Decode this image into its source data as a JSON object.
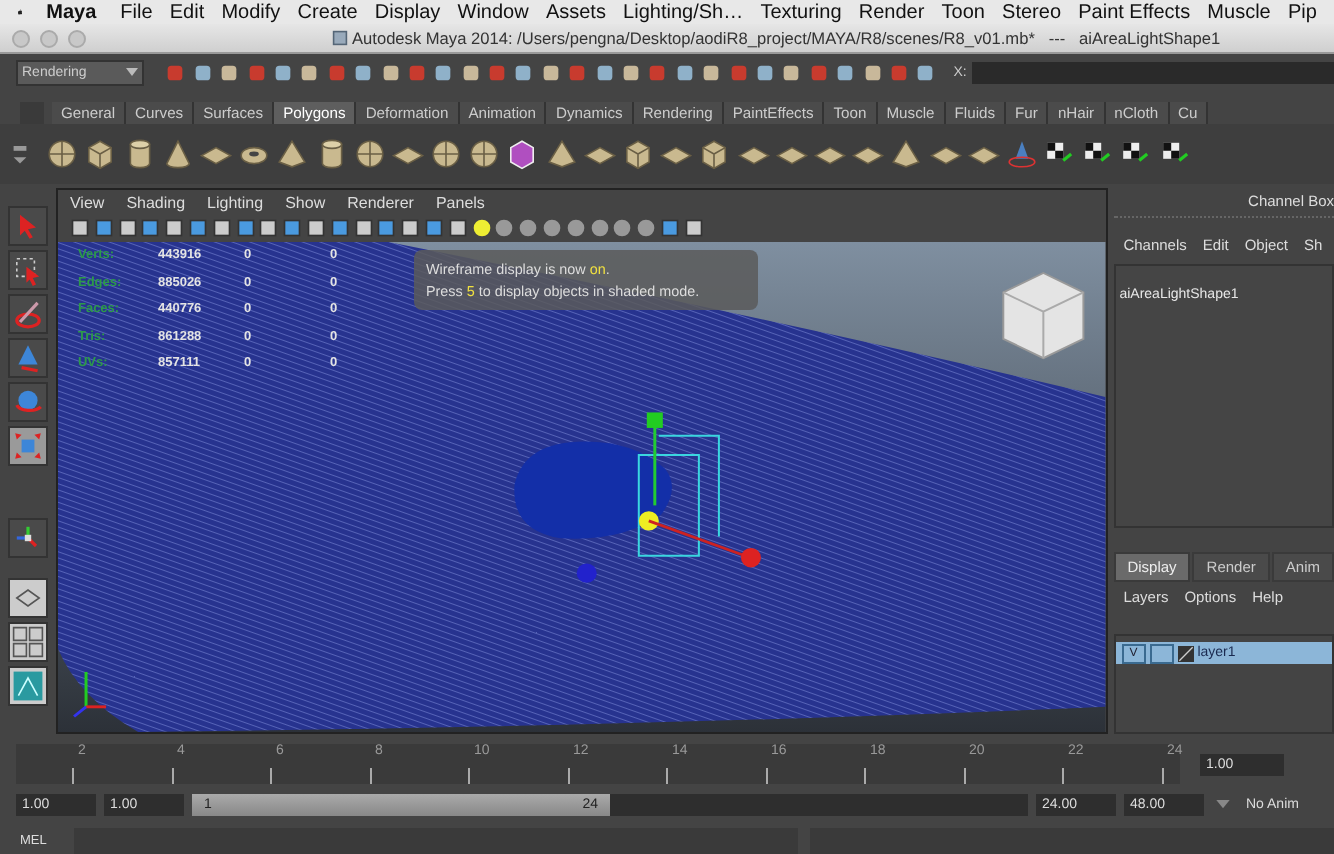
{
  "menu_bar": {
    "app": "Maya",
    "items": [
      "File",
      "Edit",
      "Modify",
      "Create",
      "Display",
      "Window",
      "Assets",
      "Lighting/Sh…",
      "Texturing",
      "Render",
      "Toon",
      "Stereo",
      "Paint Effects",
      "Muscle",
      "Pip"
    ]
  },
  "window": {
    "title": "Autodesk Maya 2014: /Users/pengna/Desktop/aodiR8_project/MAYA/R8/scenes/R8_v01.mb*   ---   aiAreaLightShape1"
  },
  "status_line": {
    "menu_set": "Rendering",
    "field_label": "X:"
  },
  "shelf": {
    "tabs": [
      {
        "label": "General",
        "selected": false
      },
      {
        "label": "Curves",
        "selected": false
      },
      {
        "label": "Surfaces",
        "selected": false
      },
      {
        "label": "Polygons",
        "selected": true
      },
      {
        "label": "Deformation",
        "selected": false
      },
      {
        "label": "Animation",
        "selected": false
      },
      {
        "label": "Dynamics",
        "selected": false
      },
      {
        "label": "Rendering",
        "selected": false
      },
      {
        "label": "PaintEffects",
        "selected": false
      },
      {
        "label": "Toon",
        "selected": false
      },
      {
        "label": "Muscle",
        "selected": false
      },
      {
        "label": "Fluids",
        "selected": false
      },
      {
        "label": "Fur",
        "selected": false
      },
      {
        "label": "nHair",
        "selected": false
      },
      {
        "label": "nCloth",
        "selected": false
      },
      {
        "label": "Cu",
        "selected": false
      }
    ]
  },
  "viewport": {
    "menus": [
      "View",
      "Shading",
      "Lighting",
      "Show",
      "Renderer",
      "Panels"
    ],
    "hud_rows": [
      {
        "label": "Verts:",
        "values": [
          "443916",
          "0",
          "0"
        ]
      },
      {
        "label": "Edges:",
        "values": [
          "885026",
          "0",
          "0"
        ]
      },
      {
        "label": "Faces:",
        "values": [
          "440776",
          "0",
          "0"
        ]
      },
      {
        "label": "Tris:",
        "values": [
          "861288",
          "0",
          "0"
        ]
      },
      {
        "label": "UVs:",
        "values": [
          "857111",
          "0",
          "0"
        ]
      }
    ],
    "message": [
      "Wireframe display is now **on**.",
      "Press **5** to display objects in shaded mode."
    ]
  },
  "channel_box": {
    "title": "Channel Box",
    "menus": [
      "Channels",
      "Edit",
      "Object",
      "Sh"
    ],
    "node": "aiAreaLightShape1"
  },
  "layer_editor": {
    "tabs": [
      {
        "label": "Display",
        "selected": true
      },
      {
        "label": "Render",
        "selected": false
      },
      {
        "label": "Anim",
        "selected": false
      }
    ],
    "menus": [
      "Layers",
      "Options",
      "Help"
    ],
    "layers": [
      {
        "visibility": "V",
        "name": "layer1",
        "selected": true
      }
    ]
  },
  "time_slider": {
    "ticks": [
      "2",
      "4",
      "6",
      "8",
      "10",
      "12",
      "14",
      "16",
      "18",
      "20",
      "22",
      "24"
    ],
    "current_frame": "1.00"
  },
  "range_slider": {
    "start": "1.00",
    "playback_start": "1.00",
    "range_start": "1",
    "range_end": "24",
    "level": 0.5,
    "playback_end": "24.00",
    "end": "48.00",
    "anim_layer": "No Anim"
  },
  "command_line": {
    "language": "MEL"
  }
}
